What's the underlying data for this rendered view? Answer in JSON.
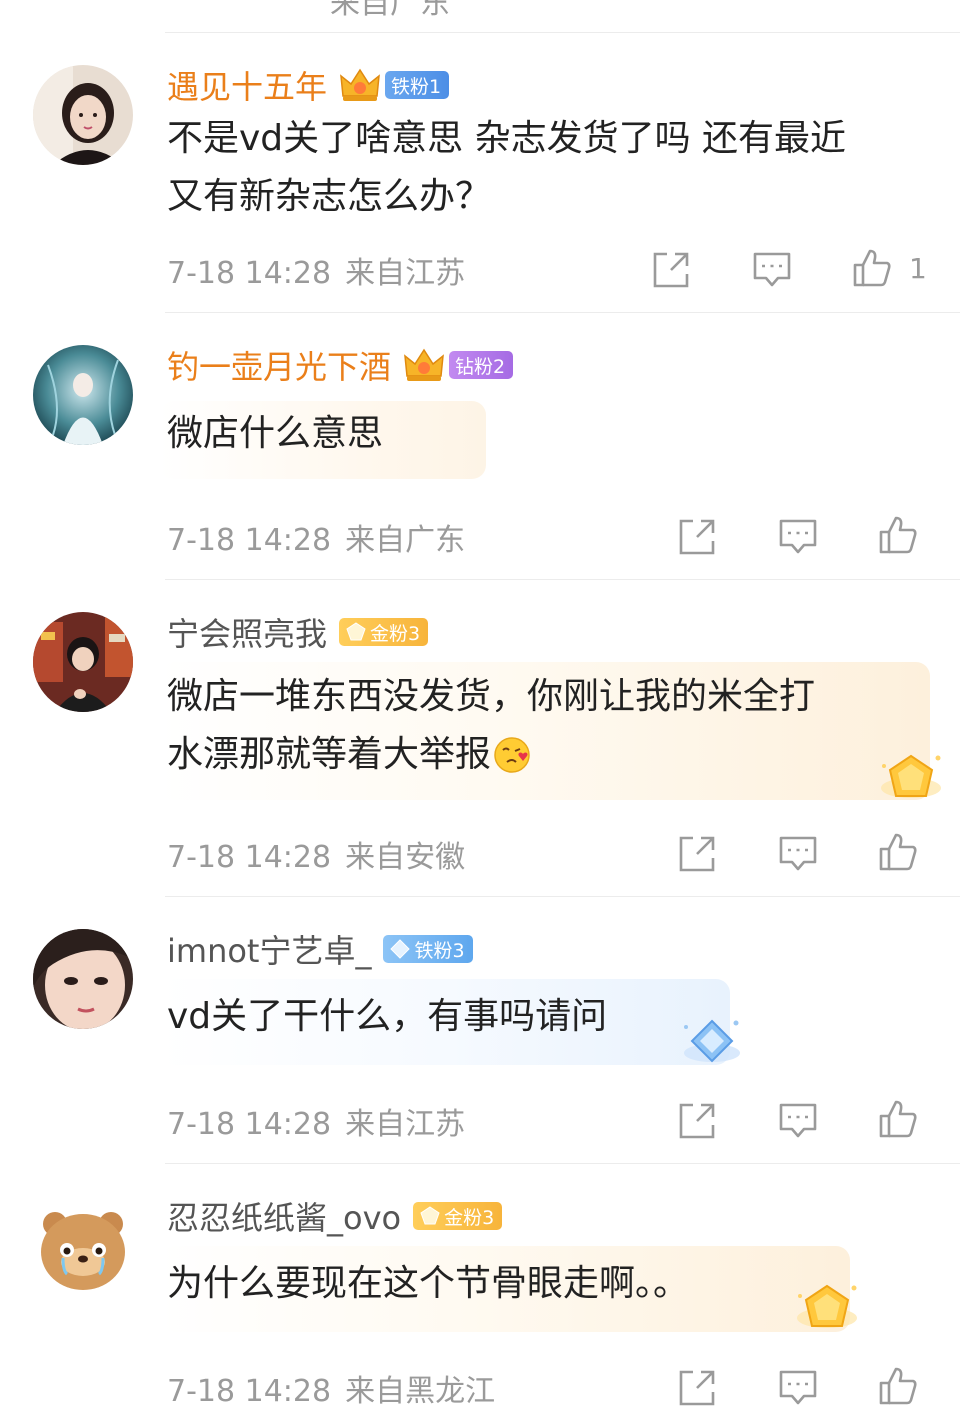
{
  "top_partial": {
    "meta_fragment": "来自广东"
  },
  "comments": [
    {
      "username": "遇见十五年",
      "badge": {
        "label": "铁粉1",
        "style": "blue"
      },
      "has_crown": true,
      "lines": [
        "不是vd关了啥意思 杂志发货了吗 还有最近",
        "又有新杂志怎么办？"
      ],
      "date": "7-18 14:28",
      "location": "来自江苏",
      "likes": "1"
    },
    {
      "username": "钓一壶月光下酒",
      "badge": {
        "label": "钻粉2",
        "style": "purple"
      },
      "has_crown": true,
      "lines": [
        "微店什么意思"
      ],
      "date": "7-18 14:28",
      "location": "来自广东",
      "likes": ""
    },
    {
      "username": "宁会照亮我",
      "badge": {
        "label": "金粉3",
        "style": "gold"
      },
      "has_crown": false,
      "lines": [
        "微店一堆东西没发货，你刚让我的米全打",
        "水漂那就等着大举报"
      ],
      "emoji": "kiss-face-emoji",
      "date": "7-18 14:28",
      "location": "来自安徽",
      "likes": ""
    },
    {
      "username": "imnot宁艺卓_",
      "badge": {
        "label": "铁粉3",
        "style": "iceblue"
      },
      "has_crown": false,
      "lines": [
        "vd关了干什么，有事吗请问"
      ],
      "date": "7-18 14:28",
      "location": "来自江苏",
      "likes": ""
    },
    {
      "username": "忍忍纸纸酱_ovo",
      "badge": {
        "label": "金粉3",
        "style": "gold"
      },
      "has_crown": false,
      "lines": [
        "为什么要现在这个节骨眼走啊。。"
      ],
      "date": "7-18 14:28",
      "location": "来自黑龙江",
      "likes": ""
    }
  ],
  "colors": {
    "vip_name": "#ea7f1a",
    "plain_name": "#555555",
    "meta": "#9a9a9a",
    "icon": "#9a9a9a"
  }
}
